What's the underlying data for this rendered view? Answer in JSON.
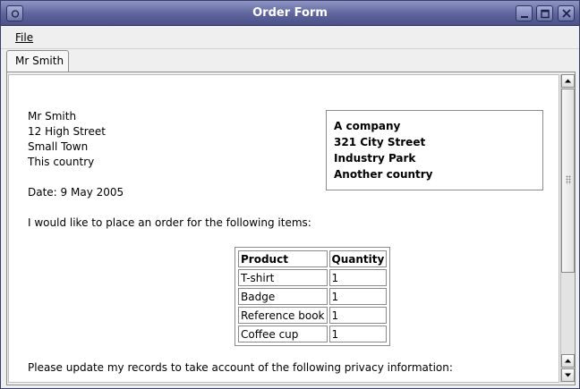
{
  "window": {
    "title": "Order Form"
  },
  "menu": {
    "file_label": "File"
  },
  "tab": {
    "label": "Mr Smith"
  },
  "sender": {
    "name": "Mr Smith",
    "street": "12 High Street",
    "town": "Small Town",
    "country": "This country"
  },
  "recipient": {
    "name": "A company",
    "street": "321 City Street",
    "area": "Industry Park",
    "country": "Another country"
  },
  "date_text": "Date: 9 May 2005",
  "intro_text": "I would like to place an order for the following items:",
  "order_table": {
    "headers": [
      "Product",
      "Quantity"
    ],
    "rows": [
      [
        "T-shirt",
        "1"
      ],
      [
        "Badge",
        "1"
      ],
      [
        "Reference book",
        "1"
      ],
      [
        "Coffee cup",
        "1"
      ]
    ]
  },
  "privacy_text": "Please update my records to take account of the following privacy information:"
}
